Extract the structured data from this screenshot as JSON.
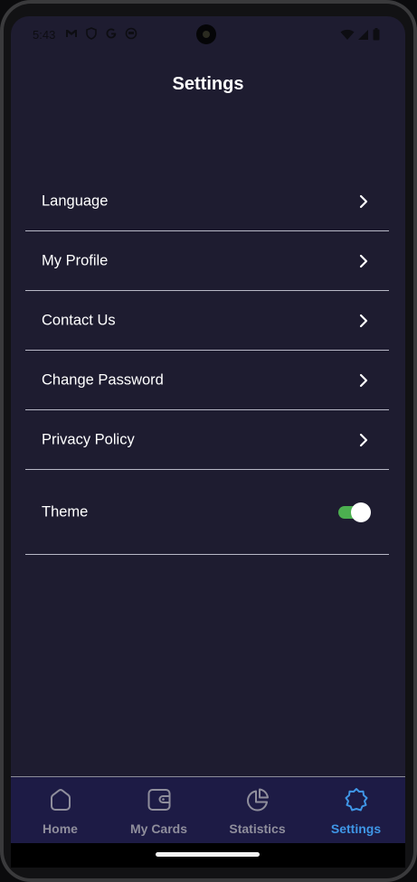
{
  "status_bar": {
    "time": "5:43",
    "left_icons": [
      "gmail-icon",
      "shield-icon",
      "google-icon",
      "face-icon"
    ],
    "right_icons": [
      "wifi-icon",
      "signal-icon",
      "battery-icon"
    ]
  },
  "header": {
    "title": "Settings"
  },
  "settings": {
    "items": [
      {
        "label": "Language",
        "icon": "chevron-right-icon"
      },
      {
        "label": "My Profile",
        "icon": "chevron-right-icon"
      },
      {
        "label": "Contact Us",
        "icon": "chevron-right-icon"
      },
      {
        "label": "Change Password",
        "icon": "chevron-right-icon"
      },
      {
        "label": "Privacy Policy",
        "icon": "chevron-right-icon"
      }
    ],
    "theme": {
      "label": "Theme",
      "toggle_on": true,
      "toggle_color": "#4caf50"
    }
  },
  "bottom_nav": {
    "items": [
      {
        "label": "Home",
        "icon": "home-icon",
        "active": false
      },
      {
        "label": "My Cards",
        "icon": "wallet-icon",
        "active": false
      },
      {
        "label": "Statistics",
        "icon": "pie-chart-icon",
        "active": false
      },
      {
        "label": "Settings",
        "icon": "gear-icon",
        "active": true
      }
    ],
    "active_color": "#3f96e6",
    "inactive_color": "#8f8e9c"
  },
  "colors": {
    "background": "#1e1c30",
    "nav_background": "#1d1b45",
    "divider": "#b8b8c6"
  }
}
